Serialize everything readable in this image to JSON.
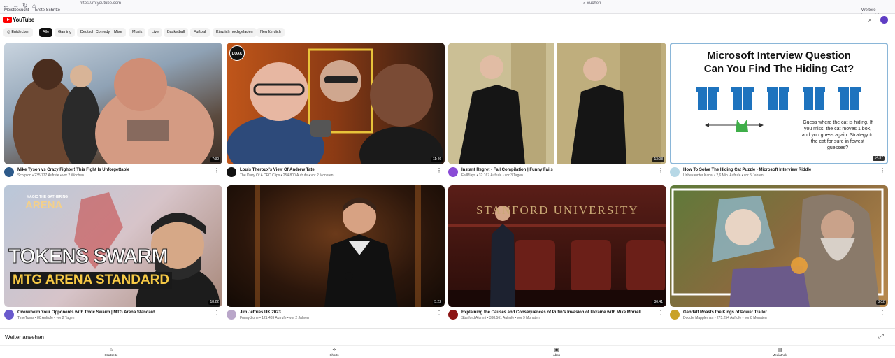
{
  "browser": {
    "url": "https://m.youtube.com",
    "search_placeholder": "Suchen",
    "bookmarks": [
      "Meistbesucht",
      "Erste Schritte"
    ],
    "bookmarks_right": "Weitere Lesezeichen"
  },
  "header": {
    "logo_text": "YouTube"
  },
  "chips": [
    "Entdecken",
    "Alle",
    "Gaming",
    "Deutsch Comedy",
    "Mixe",
    "Musik",
    "Live",
    "Basketball",
    "Fußball",
    "Kürzlich hochgeladen",
    "Neu für dich"
  ],
  "videos": [
    {
      "title": "Mike Tyson vs Crazy Fighter! This Fight Is Unforgettable",
      "meta": "Scorpion • 235.777 Aufrufe • vor 2 Wochen",
      "duration": "7:30",
      "avatar_color": "#2d5a8a"
    },
    {
      "title": "Louis Theroux's View Of Andrew Tate",
      "meta": "The Diary Of A CEO Clips • 254.800 Aufrufe • vor 2 Monaten",
      "duration": "11:46",
      "avatar_color": "#111111"
    },
    {
      "title": "Instant Regret - Fail Compilation | Funny Fails",
      "meta": "FailPlays • 32.167 Aufrufe • vor 3 Tagen",
      "duration": "13:08",
      "avatar_color": "#8a4bd6"
    },
    {
      "title": "How To Solve The Hiding Cat Puzzle - Microsoft Interview Riddle",
      "meta": "Unbekannter Kanal • 2,6 Mio. Aufrufe • vor 5 Jahren",
      "duration": "14:37",
      "avatar_color": "#b7d8e6"
    },
    {
      "title": "Overwhelm Your Opponents with Toxic Swarm | MTG Arena Standard",
      "meta": "TimeTurns • 80 Aufrufe • vor 2 Tagen",
      "duration": "18:22",
      "avatar_color": "#6a5acd"
    },
    {
      "title": "Jim Jeffries UK 2023",
      "meta": "Funny Zone • 121.489 Aufrufe • vor 2 Jahren",
      "duration": "5:22",
      "avatar_color": "#b9a6c9"
    },
    {
      "title": "Explaining the Causes and Consequences of Putin's Invasion of Ukraine with Mike Morrell",
      "meta": "Stanford Alumni • 338.561 Aufrufe • vor 9 Monaten",
      "duration": "30:41",
      "avatar_color": "#8c1515"
    },
    {
      "title": "Gandalf Roasts the Kings of Power Trailer",
      "meta": "Doodle Mappleman • 275.254 Aufrufe • vor 8 Monaten",
      "duration": "3:02",
      "avatar_color": "#c9a227"
    }
  ],
  "thumb_text": {
    "doac": "DOAC",
    "cat_title_1": "Microsoft Interview Question",
    "cat_title_2": "Can You Find The Hiding Cat?",
    "cat_desc": [
      "Guess where the cat is hiding. If",
      "you miss, the cat moves 1 box,",
      "and you guess again. Strategy to",
      "the cat for sure in fewest",
      "guesses?"
    ],
    "mtg_small": "MAGIC THE GATHERING",
    "mtg_arena": "ARENA",
    "mtg_tokens": "TOKENS SWARM",
    "mtg_standard": "MTG ARENA STANDARD",
    "stanford": "STANFORD UNIVERSITY"
  },
  "continue_watching": "Weiter ansehen",
  "bottom_nav": [
    {
      "label": "Startseite",
      "icon": "home-icon"
    },
    {
      "label": "Shorts",
      "icon": "shorts-icon"
    },
    {
      "label": "Abos",
      "icon": "subscriptions-icon"
    },
    {
      "label": "Mediathek",
      "icon": "library-icon"
    }
  ]
}
